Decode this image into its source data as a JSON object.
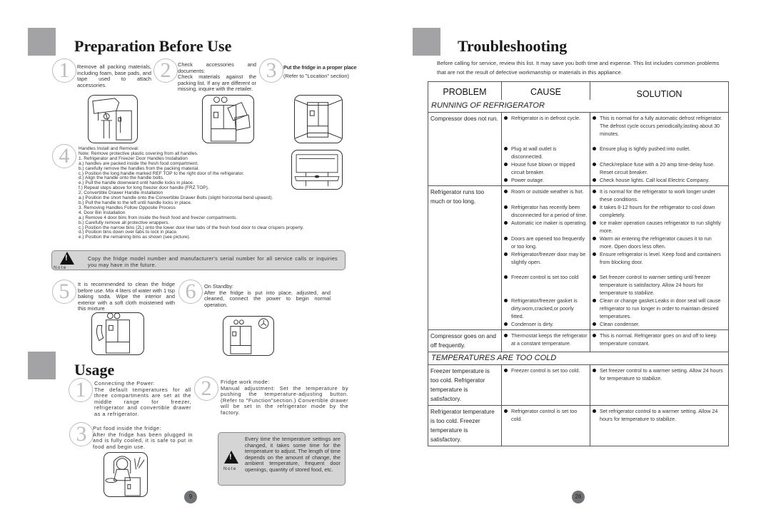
{
  "left_page": {
    "title": "Preparation Before Use",
    "steps": [
      {
        "number": "1",
        "text": "Remove all packing materials, including foam, base pads, and tape used to attach accessories."
      },
      {
        "number": "2",
        "text": "Check accessories and documents:\nCheck materials against the packing list. If any are different or missing, inquire with the retailer."
      },
      {
        "number": "3",
        "title": "Put the fridge in a proper place",
        "text": "(Refer to \"Location\" section)"
      },
      {
        "number": "4",
        "lines": [
          "Handles Install and Removal:",
          "Note:  Remove protective plastic covering from all handles.",
          "1. Refrigerator and Freezer Door Handles Installation",
          "a.) handles are packed inside the fresh food compartment.",
          "b.) carefully remove the handles from the packing material.",
          "c.) Position the long handle marked REF TOP to the right door of the refrigerator.",
          "d.) Align the handle onto the handle bolts.",
          "e.) Pull the handle downward until handle locks in place.",
          "f.) Repeat steps above for long freezer door handle (FRZ TOP).",
          "2. Convertible Drawer Handle Installation",
          "a.) Position the short handle onto the Convertible Drawer Bolts (slight horizontal bend upward).",
          "b.) Pull the handle to the left until handle locks in place.",
          "3. Removing Handles Follow Opposite Process",
          "4. Door Bin Installation",
          "a.) Remove 4 door bins from inside the fresh food and freezer compartments.",
          "b.) Carefully remove all protective wrappers.",
          "c.) Position the narrow bins (2L) onto the lower door liner tabs of the fresh food door to clear crispers properly.",
          "d.) Position bins down over tabs to lock in place.",
          "e.) Position the remaining bins as shown (see picture)."
        ]
      },
      {
        "number": "5",
        "text": "It is recommended to clean the fridge before use.  Mix 4 liters of water with 1 tsp baking soda.  Wipe the interior and exterior with a soft cloth moistened with this mixture"
      },
      {
        "number": "6",
        "text": "On Standby:\nAfter the fridge is put into place, adjusted, and cleaned, connect the power to begin normal operation."
      }
    ],
    "note1": {
      "label": "Note",
      "text": "Copy the fridge model number and manufacturer's serial number for all service calls or inquiries you may have in the future."
    },
    "usage_title": "Usage",
    "usage_steps": [
      {
        "number": "1",
        "text": "Connecting the Power:\nThe default temperatures for all three compartments are set at the middle range for freezer, refrigerator and convertible drawer as a refrigerator."
      },
      {
        "number": "2",
        "text": "Fridge work mode:\nManual adjustment: Set the temperature by pushing the temperature-adjusting button. (Refer to \"Function\"section.)   Convertible drawer will be set in the refrigerator mode by the factory."
      },
      {
        "number": "3",
        "text": "Put food inside the fridge:\nAfter the fridge has been plugged in and is fully cooled, it is safe to put in food and begin use."
      }
    ],
    "note2": {
      "label": "Note",
      "text": "Every time the temperature settings are changed, it takes some time for the temperature to adjust.  The length of time depends on the amount of change, the ambient temperature, frequent door openings, quantity of stored food, etc."
    },
    "page_number": "9"
  },
  "right_page": {
    "title": "Troubleshooting",
    "intro": "Before calling for service, review this list. It may save you both time and expense. This list includes common problems that are not the result of defective workmanship or materials in this appliance.",
    "headers": {
      "problem": "PROBLEM",
      "cause": "CAUSE",
      "solution": "SOLUTION"
    },
    "sections": [
      {
        "title": "RUNNING OF REFRIGERATOR",
        "rows": [
          {
            "problem": "Compressor does not run.",
            "groups": [
              {
                "causes": [
                  "Refrigerator is in defrost cycle."
                ],
                "solutions": [
                  "This is normal for a fully automatic defrost refrigerator. The defrost cycle occurs periodically,lasting about 30 minutes."
                ]
              },
              {
                "causes": [
                  "Plug at wall outlet is disconnected.",
                  "House fuse blown or tripped circuit breaker.",
                  "Power outage."
                ],
                "solutions": [
                  "Ensure plug is tightly pushed into outlet.",
                  "Check/replace fuse with a 20 amp time-delay fuse. Reset circuit breaker.",
                  "Check house lights.  Call local Electric Company."
                ]
              }
            ]
          },
          {
            "problem": "Refrigerator runs too much or too long.",
            "groups": [
              {
                "causes": [
                  "Room or outside weather is hot.",
                  "Refrigerator has recently been disconnected for a period of time.",
                  "Automatic ice maker is operating.",
                  "Doors are opened too frequently or too long.",
                  "Refrigerator/freezer door may be slightly open."
                ],
                "solutions": [
                  "It is normal for the refrigerator to work longer under these conditions.",
                  "It takes 8-12 hours for the refrigerator to cool down completely.",
                  "Ice maker operation causes refrigerator to run slightly more.",
                  "Warm air entering the refrigerator causes it to run more. Open doors less often.",
                  "Ensure refrigerator is level. Keep food and containers from blocking door."
                ]
              },
              {
                "causes": [
                  "Freezer control is set too cold",
                  "Refrigerator/freezer gasket is dirty,worn,cracked,or poorly fitted.",
                  "Condenser is dirty."
                ],
                "solutions": [
                  "Set freezer control to warmer setting until freezer temperature is satisfactory. Allow 24 hours for temperature to stabilize.",
                  "Clean or change gasket.Leaks in door seal will cause refrigerator to run longer in order to maintain desired temperatures.",
                  "Clean condenser."
                ]
              }
            ]
          },
          {
            "problem": "Compressor goes on and off frequently.",
            "groups": [
              {
                "causes": [
                  "Thermostat keeps the refrigerator at a constant temperature."
                ],
                "solutions": [
                  "This is normal. Refrigerator goes on and off to keep temperature constant."
                ]
              }
            ]
          }
        ]
      },
      {
        "title": "TEMPERATURES ARE TOO COLD",
        "rows": [
          {
            "problem": "Freezer temperature is too cold. Refrigerator temperature is satisfactory.",
            "groups": [
              {
                "causes": [
                  "Freezer control is set too cold."
                ],
                "solutions": [
                  "Set freezer control to a warmer setting. Allow 24 hours for temperature to stabilize."
                ]
              }
            ]
          },
          {
            "problem": "Refrigerator temperature is too cold. Freezer temperature is satisfactory.",
            "groups": [
              {
                "causes": [
                  "Refrigerator control is set too cold."
                ],
                "solutions": [
                  "Set refrigerator control to a warmer setting. Allow 24 hours for temperature to stabilize."
                ]
              }
            ]
          }
        ]
      }
    ],
    "page_number": "26"
  }
}
